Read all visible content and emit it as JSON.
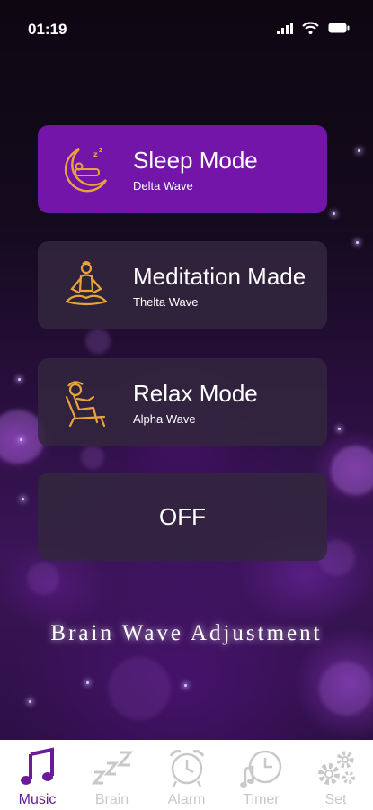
{
  "status_bar": {
    "time": "01:19",
    "icons": [
      "signal-icon",
      "wifi-icon",
      "battery-icon"
    ]
  },
  "modes": [
    {
      "title": "Sleep Mode",
      "subtitle": "Delta Wave",
      "icon": "sleeping-moon-icon",
      "active": true
    },
    {
      "title": "Meditation Made",
      "subtitle": "Thelta Wave",
      "icon": "meditation-icon",
      "active": false
    },
    {
      "title": "Relax Mode",
      "subtitle": "Alpha Wave",
      "icon": "relax-chair-icon",
      "active": false
    }
  ],
  "off_button": {
    "label": "OFF"
  },
  "footer_title": "Brain Wave Adjustment",
  "tabs": [
    {
      "label": "Music",
      "icon": "music-note-icon",
      "active": true
    },
    {
      "label": "Brain",
      "icon": "zzz-icon",
      "active": false
    },
    {
      "label": "Alarm",
      "icon": "alarm-clock-icon",
      "active": false
    },
    {
      "label": "Timer",
      "icon": "timer-icon",
      "active": false
    },
    {
      "label": "Set",
      "icon": "gear-icon",
      "active": false
    }
  ],
  "colors": {
    "accent": "#7415aa",
    "card": "#32263e",
    "icon_gold": "#e8a43c",
    "tab_active": "#6a1b9a",
    "tab_inactive": "#c9c9c9"
  }
}
